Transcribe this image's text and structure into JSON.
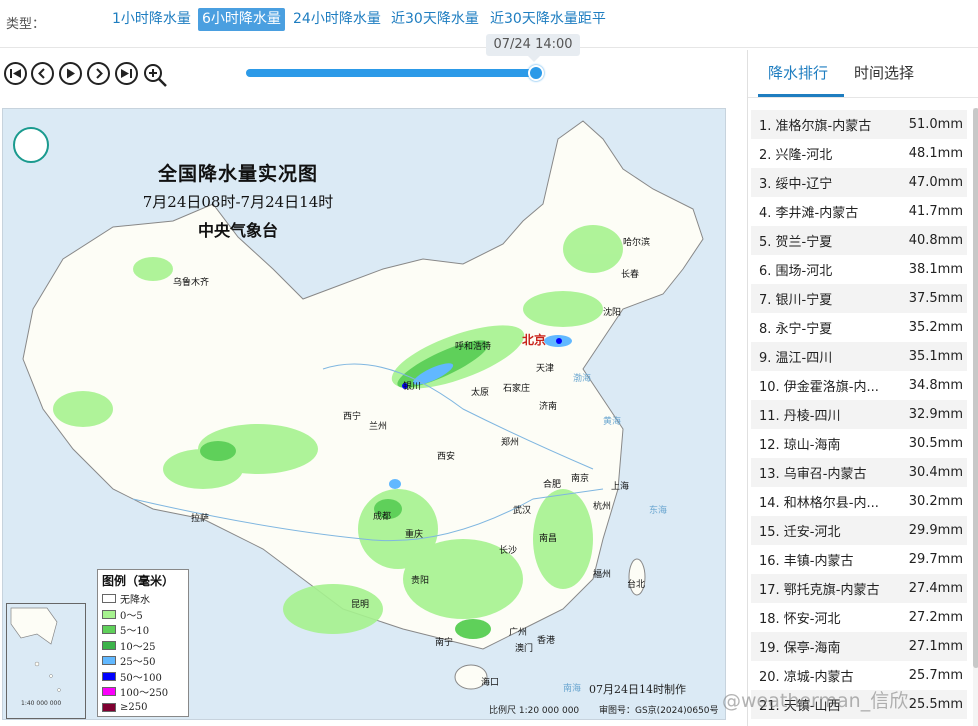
{
  "type_bar": {
    "label": "类型：",
    "options": [
      "1小时降水量",
      "6小时降水量",
      "24小时降水量",
      "近30天降水量",
      "近30天降水量距平"
    ],
    "active_index": 1
  },
  "controls": {
    "buttons": [
      "first-frame-icon",
      "prev-frame-icon",
      "play-icon",
      "next-frame-icon",
      "last-frame-icon",
      "zoom-in-icon"
    ],
    "time_tip": "07/24 14:00",
    "slider_position": 1.0
  },
  "map": {
    "title": "全国降水量实况图",
    "subtitle": "7月24日08时-7月24日14时",
    "agency": "中央气象台",
    "cities": [
      "乌鲁木齐",
      "哈尔滨",
      "长春",
      "沈阳",
      "北京",
      "呼和浩特",
      "天津",
      "银川",
      "太原",
      "石家庄",
      "西宁",
      "兰州",
      "济南",
      "郑州",
      "西安",
      "合肥",
      "南京",
      "上海",
      "拉萨",
      "成都",
      "武汉",
      "杭州",
      "重庆",
      "长沙",
      "南昌",
      "福州",
      "台北",
      "贵阳",
      "昆明",
      "南宁",
      "广州",
      "香港",
      "澳门",
      "海口"
    ],
    "seas": [
      "渤海",
      "黄海",
      "东海",
      "南海"
    ],
    "legend_title": "图例（毫米）",
    "legend": [
      {
        "label": "无降水",
        "color": "#ffffff"
      },
      {
        "label": "0～5",
        "color": "#a6f28f"
      },
      {
        "label": "5～10",
        "color": "#5fd05a"
      },
      {
        "label": "10～25",
        "color": "#3cb34a"
      },
      {
        "label": "25～50",
        "color": "#61b8ff"
      },
      {
        "label": "50～100",
        "color": "#0000fe"
      },
      {
        "label": "100～250",
        "color": "#fa00fa"
      },
      {
        "label": "≥250",
        "color": "#7f0031"
      }
    ],
    "made_time": "07月24日14时制作",
    "scale_text": "比例尺 1:20 000 000",
    "review_no": "审图号：GS京(2024)0650号",
    "inset_scale": "1:40 000 000"
  },
  "right_panel": {
    "tabs": [
      "降水排行",
      "时间选择"
    ],
    "active_tab": 0,
    "ranking": [
      {
        "name": "1. 准格尔旗-内蒙古",
        "value": "51.0mm"
      },
      {
        "name": "2. 兴隆-河北",
        "value": "48.1mm"
      },
      {
        "name": "3. 绥中-辽宁",
        "value": "47.0mm"
      },
      {
        "name": "4. 李井滩-内蒙古",
        "value": "41.7mm"
      },
      {
        "name": "5. 贺兰-宁夏",
        "value": "40.8mm"
      },
      {
        "name": "6. 围场-河北",
        "value": "38.1mm"
      },
      {
        "name": "7. 银川-宁夏",
        "value": "37.5mm"
      },
      {
        "name": "8. 永宁-宁夏",
        "value": "35.2mm"
      },
      {
        "name": "9. 温江-四川",
        "value": "35.1mm"
      },
      {
        "name": "10. 伊金霍洛旗-内...",
        "value": "34.8mm"
      },
      {
        "name": "11. 丹棱-四川",
        "value": "32.9mm"
      },
      {
        "name": "12. 琼山-海南",
        "value": "30.5mm"
      },
      {
        "name": "13. 乌审召-内蒙古",
        "value": "30.4mm"
      },
      {
        "name": "14. 和林格尔县-内...",
        "value": "30.2mm"
      },
      {
        "name": "15. 迁安-河北",
        "value": "29.9mm"
      },
      {
        "name": "16. 丰镇-内蒙古",
        "value": "29.7mm"
      },
      {
        "name": "17. 鄂托克旗-内蒙古",
        "value": "27.4mm"
      },
      {
        "name": "18. 怀安-河北",
        "value": "27.2mm"
      },
      {
        "name": "19. 保亭-海南",
        "value": "27.1mm"
      },
      {
        "name": "20. 凉城-内蒙古",
        "value": "25.7mm"
      },
      {
        "name": "21. 天镇-山西",
        "value": "25.5mm"
      }
    ]
  },
  "watermark": "@weatherman_信欣"
}
